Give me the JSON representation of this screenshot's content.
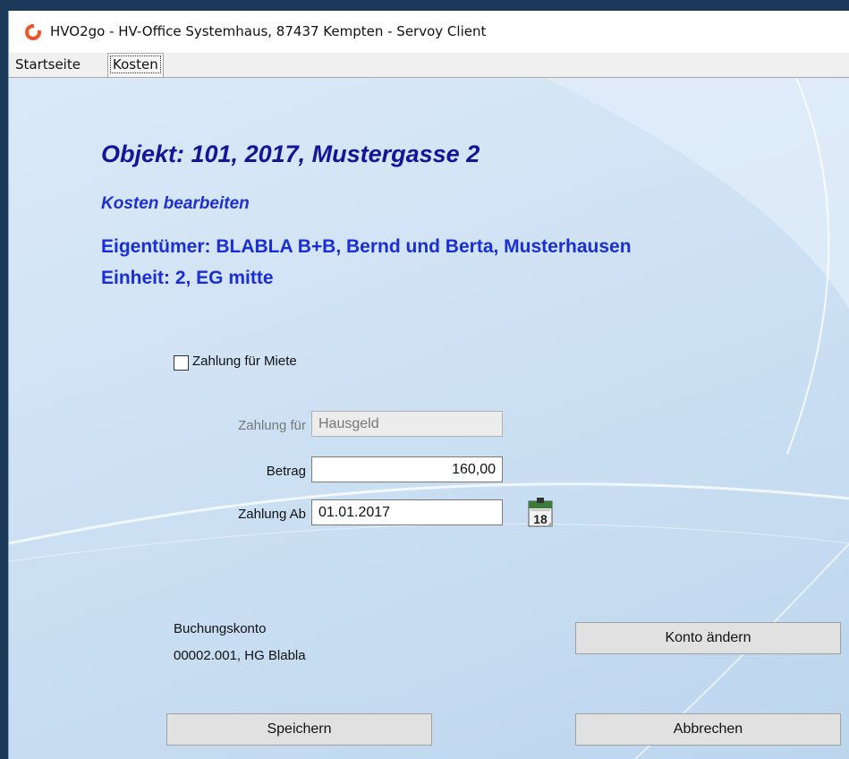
{
  "window": {
    "title": "HVO2go - HV-Office Systemhaus, 87437 Kempten  - Servoy Client",
    "icon": "app-logo-icon"
  },
  "tabs": [
    {
      "label": "Startseite",
      "active": false
    },
    {
      "label": "Kosten",
      "active": true
    }
  ],
  "form": {
    "heading": "Objekt: 101, 2017, Mustergasse 2",
    "subheading": "Kosten bearbeiten",
    "owner": "Eigentümer: BLABLA B+B, Bernd und Berta, Musterhausen",
    "unit": "Einheit: 2, EG mitte",
    "checkbox_label": "Zahlung für Miete",
    "checkbox_checked": false,
    "zahlung_fuer_label": "Zahlung für",
    "zahlung_fuer_value": "Hausgeld",
    "betrag_label": "Betrag",
    "betrag_value": "160,00",
    "zahlung_ab_label": "Zahlung Ab",
    "zahlung_ab_value": "01.01.2017",
    "calendar_day": "18",
    "buchungskonto_label": "Buchungskonto",
    "buchungskonto_value": "00002.001, HG Blabla",
    "konto_button": "Konto ändern",
    "save_button": "Speichern",
    "cancel_button": "Abbrechen"
  },
  "colors": {
    "heading": "#14149a",
    "accent": "#1f2fd6",
    "logo": "#e8562a"
  }
}
